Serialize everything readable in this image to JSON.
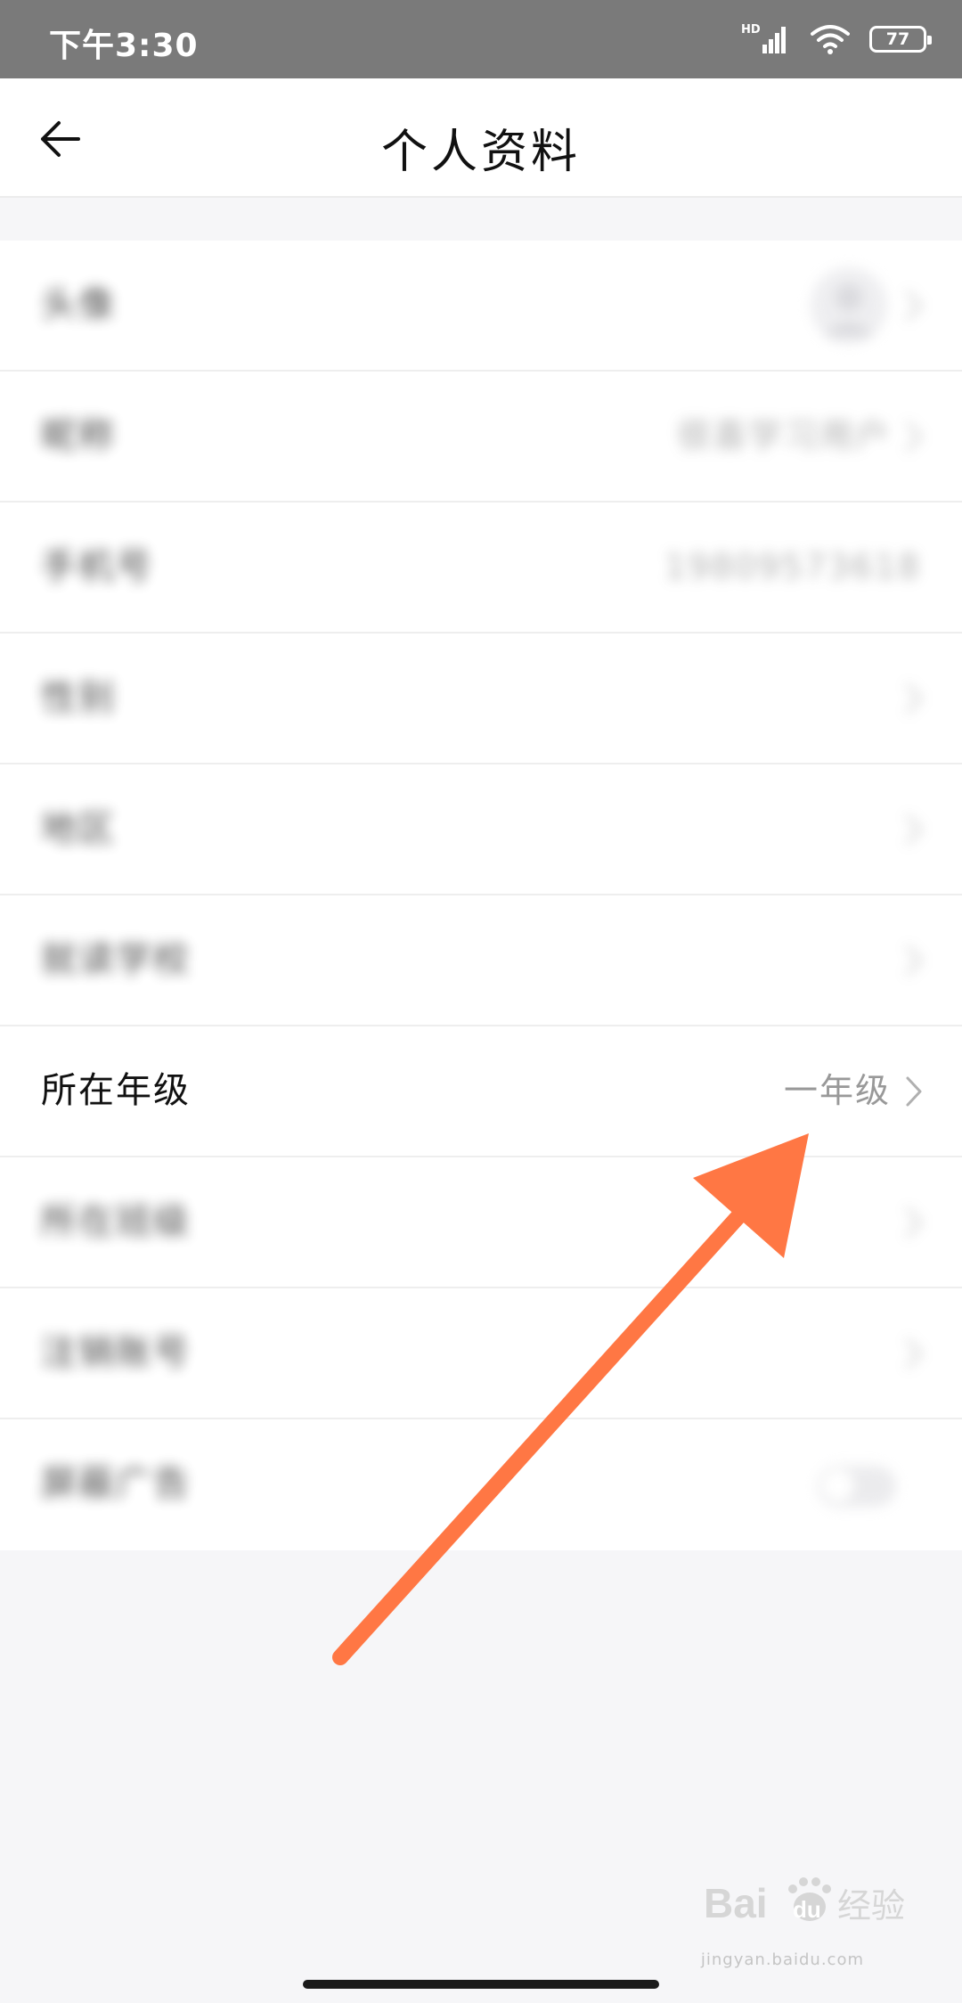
{
  "status_bar": {
    "time": "下午3:30",
    "network_label": "HD",
    "battery_level": "77"
  },
  "header": {
    "title": "个人资料",
    "back_icon": "arrow-left-icon"
  },
  "profile_rows": [
    {
      "label": "头像",
      "value": "",
      "blurred": true,
      "trailing": "avatar"
    },
    {
      "label": "昵称",
      "value": "很喜学习用户",
      "blurred": true,
      "trailing": "chevron"
    },
    {
      "label": "手机号",
      "value": "19809573618",
      "blurred": true,
      "trailing": "none"
    },
    {
      "label": "性别",
      "value": "",
      "blurred": true,
      "trailing": "chevron"
    },
    {
      "label": "地区",
      "value": "",
      "blurred": true,
      "trailing": "chevron"
    },
    {
      "label": "就读学校",
      "value": "",
      "blurred": true,
      "trailing": "chevron"
    },
    {
      "label": "所在年级",
      "value": "一年级",
      "blurred": false,
      "trailing": "chevron"
    },
    {
      "label": "所在班级",
      "value": "",
      "blurred": true,
      "trailing": "chevron"
    },
    {
      "label": "注销账号",
      "value": "",
      "blurred": true,
      "trailing": "chevron"
    },
    {
      "label": "屏蔽广告",
      "value": "",
      "blurred": true,
      "trailing": "toggle",
      "toggle_on": false
    }
  ],
  "annotation": {
    "arrow_color": "#ff7744",
    "icon": "pointer-arrow-icon"
  },
  "watermark": {
    "brand": "Bai",
    "brand_suffix": "du",
    "product": "经验",
    "domain": "jingyan.baidu.com"
  },
  "colors": {
    "status_bar_bg": "#7a7a7a",
    "page_bg": "#f6f6f8",
    "row_bg": "#ffffff",
    "value_text": "#999999"
  }
}
